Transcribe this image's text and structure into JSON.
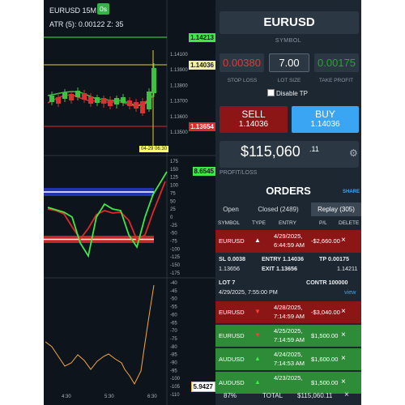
{
  "chart": {
    "symbol_tf": "EURUSD 15M",
    "tf_badge": "0s",
    "atr_text": "ATR (5): 0.00122  Z: 35",
    "price_ticks": [
      "1.14100",
      "1.13900",
      "1.13800",
      "1.13700",
      "1.13600",
      "1.13500"
    ],
    "osc_ticks": [
      "175",
      "150",
      "125",
      "100",
      "75",
      "50",
      "25",
      "0",
      "-25",
      "-50",
      "-75",
      "-100",
      "-125",
      "-150",
      "-175"
    ],
    "atr_ticks": [
      "-40",
      "-45",
      "-50",
      "-55",
      "-60",
      "-65",
      "-70",
      "-75",
      "-80",
      "-85",
      "-90",
      "-95",
      "-100",
      "-105",
      "-110"
    ],
    "labels": {
      "high": "1.14213",
      "current": "1.14036",
      "low": "1.13654",
      "osc": "8.6545",
      "atr_value": "5.9427"
    },
    "date_tag": "04-29 06:30",
    "x_ticks": [
      "4:30",
      "5:30",
      "6:30"
    ],
    "colors": {
      "bg": "#0d141b",
      "up": "#3ec040",
      "down": "#d83232",
      "osc_green": "#3ee84a",
      "osc_red": "#e02828",
      "atr_line": "#f5a742"
    }
  },
  "order": {
    "symbol": "EURUSD",
    "symbol_caption": "SYMBOL",
    "stop_loss": "0.00380",
    "lot_size": "7.00",
    "take_profit": "0.00175",
    "stop_loss_caption": "STOP LOSS",
    "lot_size_caption": "LOT SIZE",
    "take_profit_caption": "TAKE PROFIT",
    "disable_tp": "Disable TP",
    "sell_label": "SELL",
    "sell_price": "1.14036",
    "buy_label": "BUY",
    "buy_price": "1.14036",
    "pnl_main": "$115,060",
    "pnl_cents": ".11",
    "pnl_caption": "PROFIT/LOSS",
    "colors": {
      "sell": "#8c1616",
      "buy": "#3aa6f3",
      "loss": "#8c1616",
      "win": "#2e8b37"
    }
  },
  "orders": {
    "title": "ORDERS",
    "share": "SHARE",
    "tabs": {
      "open": "Open",
      "closed": "Closed (2489)",
      "replay": "Replay (305)"
    },
    "headers": {
      "symbol": "SYMBOL",
      "type": "TYPE",
      "entry": "ENTRY",
      "pl": "P/L",
      "delete": "DELETE"
    },
    "rows": [
      {
        "symbol": "EURUSD",
        "dir": "up",
        "date": "4/29/2025,",
        "time": "6:44:59 AM",
        "pl": "-$2,660.00",
        "result": "loss"
      },
      {
        "symbol": "EURUSD",
        "dir": "down",
        "date": "4/28/2025,",
        "time": "7:14:59 AM",
        "pl": "-$3,040.00",
        "result": "loss"
      },
      {
        "symbol": "EURUSD",
        "dir": "down",
        "date": "4/25/2025,",
        "time": "7:14:59 AM",
        "pl": "$1,500.00",
        "result": "win"
      },
      {
        "symbol": "AUDUSD",
        "dir": "up",
        "date": "4/24/2025,",
        "time": "7:14:53 AM",
        "pl": "$1,600.00",
        "result": "win"
      },
      {
        "symbol": "AUDUSD",
        "dir": "up",
        "date": "4/23/2025,",
        "time": "",
        "pl": "$1,500.00",
        "result": "win"
      }
    ],
    "detail": {
      "sl": "SL 0.0038",
      "entry": "ENTRY 1.14036",
      "tp": "TP 0.00175",
      "sl_price": "1.13656",
      "exit": "EXIT 1.13656",
      "tp_price": "1.14211",
      "lot": "LOT 7",
      "contr": "CONTR 100000",
      "time": "4/29/2025, 7:55:00 PM",
      "view": "view"
    },
    "footer": {
      "pct": "87%",
      "total_label": "TOTAL",
      "total": "$115,060.11",
      "close": "×"
    }
  }
}
